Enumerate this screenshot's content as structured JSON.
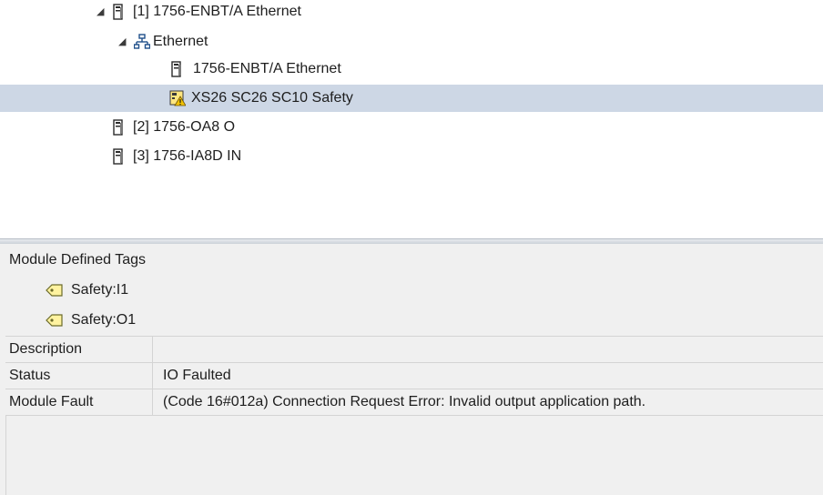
{
  "tree": {
    "items": [
      {
        "label": "[1] 1756-ENBT/A Ethernet",
        "icon": "module-icon",
        "expanded": true
      },
      {
        "label": "Ethernet",
        "icon": "network-icon",
        "expanded": true
      },
      {
        "label": "1756-ENBT/A Ethernet",
        "icon": "module-icon"
      },
      {
        "label": "XS26 SC26 SC10 Safety",
        "icon": "warning-module-icon",
        "selected": true
      },
      {
        "label": "[2] 1756-OA8 O",
        "icon": "module-icon"
      },
      {
        "label": "[3] 1756-IA8D IN",
        "icon": "module-icon"
      }
    ]
  },
  "properties": {
    "tags_header": "Module Defined Tags",
    "tags": [
      {
        "label": "Safety:I1",
        "icon": "tag-icon"
      },
      {
        "label": "Safety:O1",
        "icon": "tag-icon"
      }
    ],
    "grid": [
      {
        "name": "Description",
        "value": ""
      },
      {
        "name": "Status",
        "value": "IO Faulted"
      },
      {
        "name": "Module Fault",
        "value": "(Code 16#012a) Connection Request Error: Invalid output application path."
      }
    ]
  },
  "colors": {
    "selection": "#cdd7e5",
    "panel": "#f0f0f0",
    "warning": "#f2c200"
  }
}
